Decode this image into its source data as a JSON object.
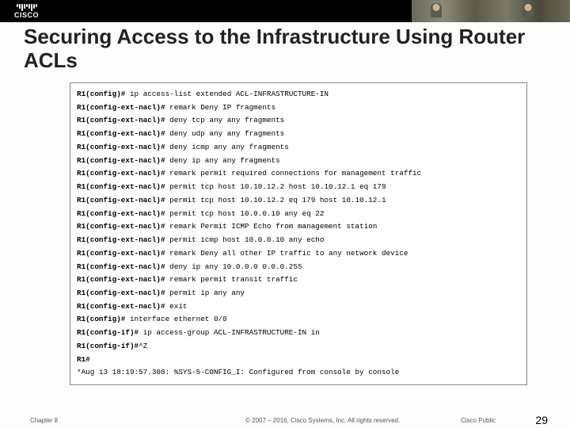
{
  "header": {
    "logo_text": "CISCO"
  },
  "title": "Securing Access to the Infrastructure Using Router ACLs",
  "terminal": {
    "lines": [
      {
        "prompt": "R1(config)#",
        "cmd": " ip access-list extended ACL-INFRASTRUCTURE-IN"
      },
      {
        "prompt": "R1(config-ext-nacl)#",
        "cmd": " remark Deny IP fragments"
      },
      {
        "prompt": "R1(config-ext-nacl)#",
        "cmd": " deny tcp any any fragments"
      },
      {
        "prompt": "R1(config-ext-nacl)#",
        "cmd": " deny udp any any fragments"
      },
      {
        "prompt": "R1(config-ext-nacl)#",
        "cmd": " deny icmp any any fragments"
      },
      {
        "prompt": "R1(config-ext-nacl)#",
        "cmd": " deny ip any any fragments"
      },
      {
        "prompt": "R1(config-ext-nacl)#",
        "cmd": " remark permit required connections for management traffic"
      },
      {
        "prompt": "R1(config-ext-nacl)#",
        "cmd": " permit tcp host 10.10.12.2 host 10.10.12.1 eq 179"
      },
      {
        "prompt": "R1(config-ext-nacl)#",
        "cmd": " permit tcp host 10.10.12.2 eq 179 host 10.10.12.1"
      },
      {
        "prompt": "R1(config-ext-nacl)#",
        "cmd": " permit tcp host 10.0.0.10 any eq 22"
      },
      {
        "prompt": "R1(config-ext-nacl)#",
        "cmd": " remark Permit ICMP Echo from management station"
      },
      {
        "prompt": "R1(config-ext-nacl)#",
        "cmd": " permit icmp host 10.0.0.10 any echo"
      },
      {
        "prompt": "R1(config-ext-nacl)#",
        "cmd": " remark Deny all other IP traffic to any network device"
      },
      {
        "prompt": "R1(config-ext-nacl)#",
        "cmd": " deny ip any 10.0.0.0 0.0.0.255"
      },
      {
        "prompt": "R1(config-ext-nacl)#",
        "cmd": " remark permit transit traffic"
      },
      {
        "prompt": "R1(config-ext-nacl)#",
        "cmd": " permit ip any any"
      },
      {
        "prompt": "R1(config-ext-nacl)#",
        "cmd": " exit"
      },
      {
        "prompt": "R1(config)#",
        "cmd": " interface ethernet 0/0"
      },
      {
        "prompt": "R1(config-if)#",
        "cmd": " ip access-group ACL-INFRASTRUCTURE-IN in"
      },
      {
        "prompt": "R1(config-if)#",
        "cmd": "^Z"
      },
      {
        "prompt": "R1#",
        "cmd": ""
      },
      {
        "prompt": "",
        "cmd": "*Aug 13 18:19:57.308: %SYS-5-CONFIG_I: Configured from console by console"
      }
    ]
  },
  "footer": {
    "chapter": "Chapter 8",
    "copyright": "© 2007 – 2016, Cisco Systems, Inc. All rights reserved.",
    "public": "Cisco Public",
    "page": "29"
  }
}
